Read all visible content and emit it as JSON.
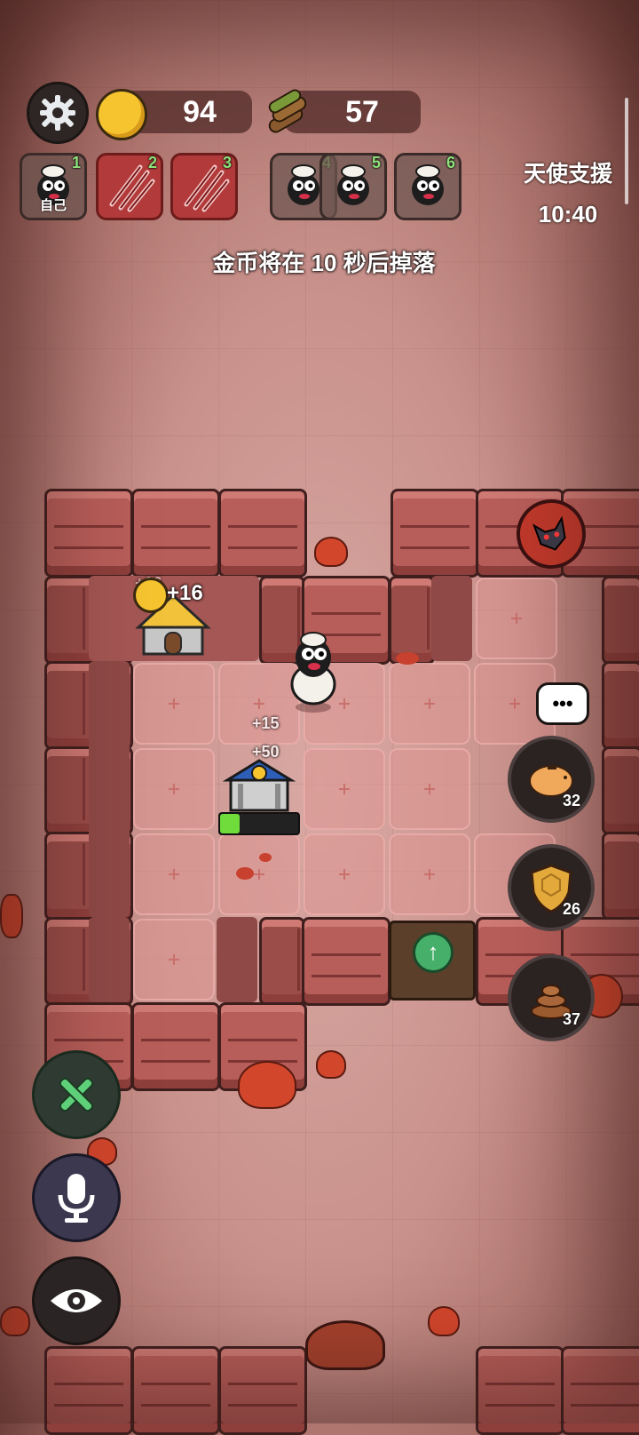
{
  "hud": {
    "coins": "94",
    "wood": "57",
    "settings_icon": "gear-icon",
    "coin_icon": "coin-icon",
    "wood_icon": "wood-logs-icon"
  },
  "players": [
    {
      "num": "1",
      "label": "自己",
      "state": "sheep"
    },
    {
      "num": "2",
      "label": "",
      "state": "attacked"
    },
    {
      "num": "3",
      "label": "",
      "state": "attacked"
    },
    {
      "num": "4",
      "label": "",
      "state": "sheep"
    },
    {
      "num": "5",
      "label": "",
      "state": "sheep"
    },
    {
      "num": "6",
      "label": "",
      "state": "sheep"
    }
  ],
  "angel_support": {
    "title": "天使支援",
    "timer": "10:40"
  },
  "notice": "金币将在 10 秒后掉落",
  "map": {
    "house_gain": "+16",
    "house_gain_faded": "+16",
    "bank_wood_gain": "+15",
    "bank_coin_gain": "+50",
    "bank_progress": 0.25
  },
  "side_buttons": {
    "piggy": {
      "icon": "piggy-bank-icon",
      "count": "32"
    },
    "shield": {
      "icon": "shield-icon",
      "count": "26"
    },
    "poop": {
      "icon": "poop-icon",
      "count": "37"
    },
    "chat_icon": "chat-bubble-icon"
  },
  "bottom_buttons": {
    "build_icon": "wrench-hammer-icon",
    "mic_icon": "microphone-icon",
    "view_icon": "eye-icon"
  },
  "colors": {
    "background": "#c9918b",
    "wall": "#b85e5a",
    "danger_slot": "#b23a3a",
    "slot_number": "#8ee07a",
    "progress_green": "#6fdc3c"
  }
}
